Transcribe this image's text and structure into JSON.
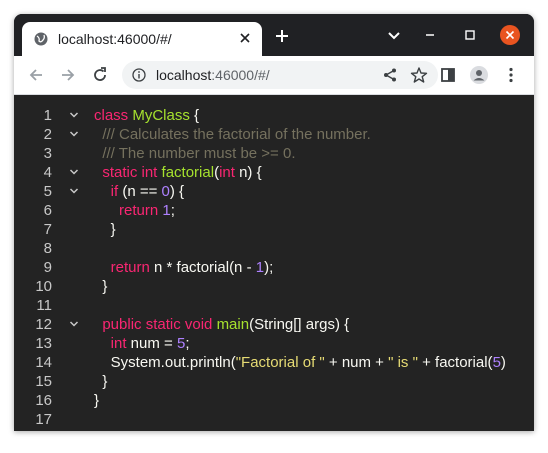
{
  "browser": {
    "tab_title": "localhost:46000/#/",
    "url_host": "localhost",
    "url_rest": ":46000/#/"
  },
  "colors": {
    "keyword": "#f92672",
    "class_name": "#a6e22e",
    "function_name": "#a6e22e",
    "number": "#ae81ff",
    "string": "#e6db74",
    "comment": "#75715e",
    "text": "#f8f8f2",
    "editor_bg": "#232323",
    "chrome_bg": "#202124"
  },
  "editor": {
    "line_numbers": [
      "1",
      "2",
      "3",
      "4",
      "5",
      "6",
      "7",
      "8",
      "9",
      "10",
      "11",
      "12",
      "13",
      "14",
      "15",
      "16",
      "17"
    ],
    "lines": [
      {
        "fold": true,
        "tokens": [
          {
            "t": "kw",
            "v": "class "
          },
          {
            "t": "cls",
            "v": "MyClass"
          },
          {
            "t": "txt",
            "v": " {"
          }
        ]
      },
      {
        "fold": true,
        "tokens": [
          {
            "t": "cmt",
            "v": "  /// Calculates the factorial of the number."
          }
        ]
      },
      {
        "fold": false,
        "tokens": [
          {
            "t": "cmt",
            "v": "  /// The number must be >= 0."
          }
        ]
      },
      {
        "fold": true,
        "tokens": [
          {
            "t": "kw",
            "v": "  static int "
          },
          {
            "t": "fn",
            "v": "factorial"
          },
          {
            "t": "txt",
            "v": "("
          },
          {
            "t": "kw",
            "v": "int"
          },
          {
            "t": "txt",
            "v": " n) {"
          }
        ]
      },
      {
        "fold": true,
        "tokens": [
          {
            "t": "kw",
            "v": "    if"
          },
          {
            "t": "txt",
            "v": " (n == "
          },
          {
            "t": "num",
            "v": "0"
          },
          {
            "t": "txt",
            "v": ") {"
          }
        ]
      },
      {
        "fold": false,
        "tokens": [
          {
            "t": "kw",
            "v": "      return "
          },
          {
            "t": "num",
            "v": "1"
          },
          {
            "t": "txt",
            "v": ";"
          }
        ]
      },
      {
        "fold": false,
        "tokens": [
          {
            "t": "txt",
            "v": "    }"
          }
        ]
      },
      {
        "fold": false,
        "tokens": []
      },
      {
        "fold": false,
        "tokens": [
          {
            "t": "kw",
            "v": "    return"
          },
          {
            "t": "txt",
            "v": " n * factorial(n - "
          },
          {
            "t": "num",
            "v": "1"
          },
          {
            "t": "txt",
            "v": ");"
          }
        ]
      },
      {
        "fold": false,
        "tokens": [
          {
            "t": "txt",
            "v": "  }"
          }
        ]
      },
      {
        "fold": false,
        "tokens": []
      },
      {
        "fold": true,
        "tokens": [
          {
            "t": "kw",
            "v": "  public static void "
          },
          {
            "t": "fn",
            "v": "main"
          },
          {
            "t": "txt",
            "v": "(String[] args) {"
          }
        ]
      },
      {
        "fold": false,
        "tokens": [
          {
            "t": "kw",
            "v": "    int"
          },
          {
            "t": "txt",
            "v": " num = "
          },
          {
            "t": "num",
            "v": "5"
          },
          {
            "t": "txt",
            "v": ";"
          }
        ]
      },
      {
        "fold": false,
        "tokens": [
          {
            "t": "txt",
            "v": "    System.out.println("
          },
          {
            "t": "str",
            "v": "\"Factorial of \""
          },
          {
            "t": "txt",
            "v": " + num + "
          },
          {
            "t": "str",
            "v": "\" is \""
          },
          {
            "t": "txt",
            "v": " + factorial("
          },
          {
            "t": "num",
            "v": "5"
          },
          {
            "t": "txt",
            "v": ")"
          }
        ]
      },
      {
        "fold": false,
        "tokens": [
          {
            "t": "txt",
            "v": "  }"
          }
        ]
      },
      {
        "fold": false,
        "tokens": [
          {
            "t": "txt",
            "v": "}"
          }
        ]
      },
      {
        "fold": false,
        "tokens": []
      }
    ]
  }
}
